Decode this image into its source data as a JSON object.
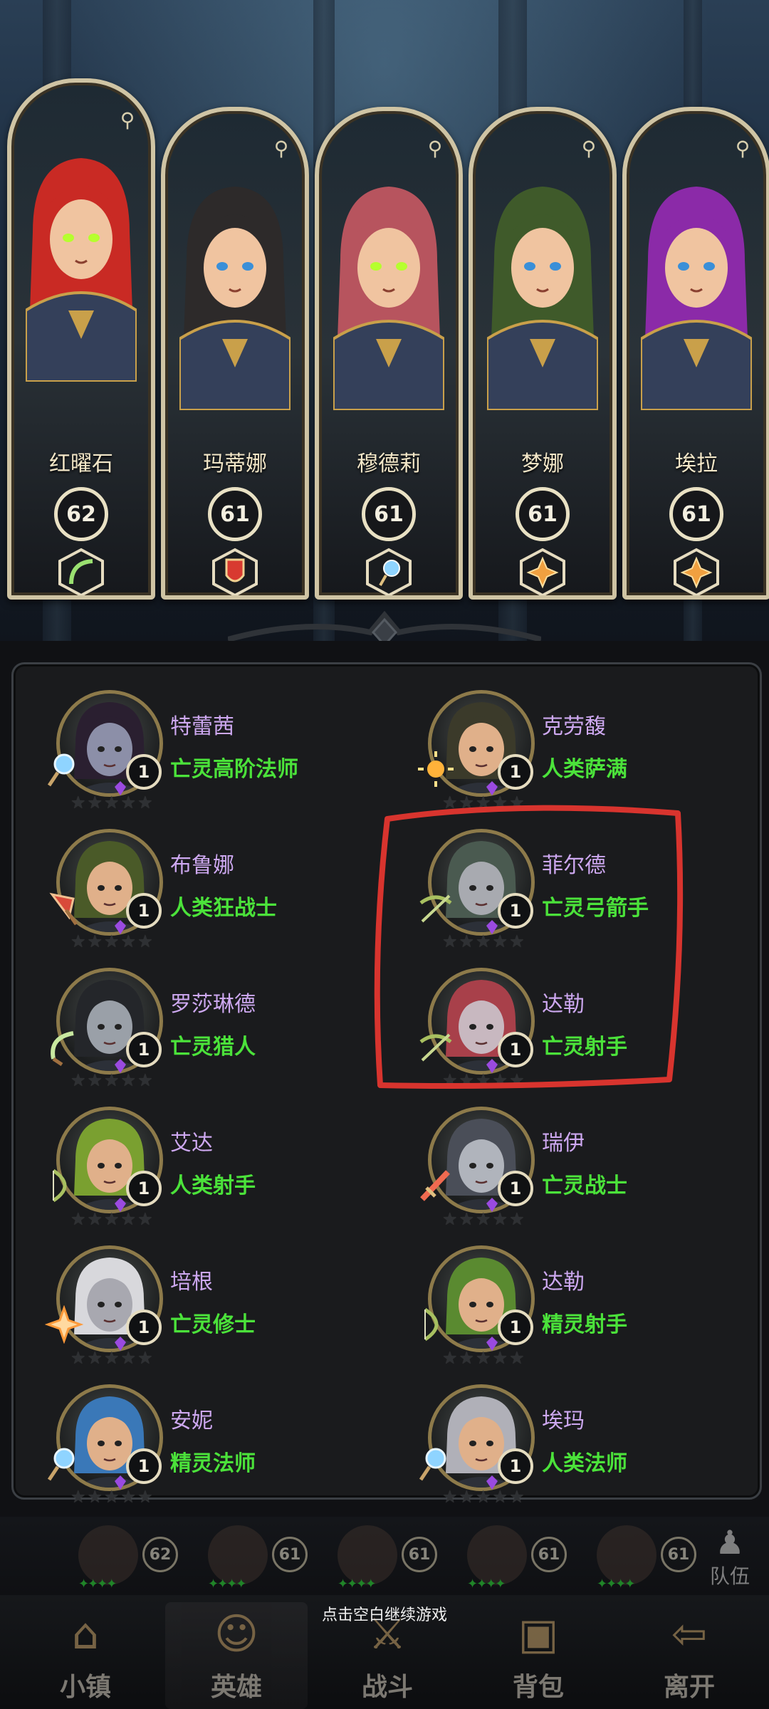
{
  "featured": [
    {
      "name": "红曜石",
      "level": "62",
      "class_icon": "scythe-icon",
      "hair": "#c92a24",
      "eyes": "#b6ff2e"
    },
    {
      "name": "玛蒂娜",
      "level": "61",
      "class_icon": "shield-icon",
      "hair": "#2d2a2a",
      "eyes": "#3a8fd8"
    },
    {
      "name": "穆德莉",
      "level": "61",
      "class_icon": "staff-orb-icon",
      "hair": "#b7545e",
      "eyes": "#b6ff2e"
    },
    {
      "name": "梦娜",
      "level": "61",
      "class_icon": "holy-emblem-icon",
      "hair": "#3f5a2a",
      "eyes": "#3a8fd8"
    },
    {
      "name": "埃拉",
      "level": "61",
      "class_icon": "holy-emblem-icon",
      "hair": "#8b2aa8",
      "eyes": "#3a8fd8"
    }
  ],
  "roster": [
    {
      "name": "特蕾茜",
      "class": "亡灵高阶法师",
      "level": "1",
      "weapon": "staff-orb-icon",
      "hair": "#2a1f30",
      "skin": "#8c8fa8"
    },
    {
      "name": "克劳馥",
      "class": "人类萨满",
      "level": "1",
      "weapon": "sun-icon",
      "hair": "#3b3a2a",
      "skin": "#e0b08a"
    },
    {
      "name": "布鲁娜",
      "class": "人类狂战士",
      "level": "1",
      "weapon": "axe-icon",
      "hair": "#4a5a28",
      "skin": "#e0b08a"
    },
    {
      "name": "菲尔德",
      "class": "亡灵弓箭手",
      "level": "1",
      "weapon": "crossbow-icon",
      "hair": "#4a5a50",
      "skin": "#a8aab0"
    },
    {
      "name": "罗莎琳德",
      "class": "亡灵猎人",
      "level": "1",
      "weapon": "sickle-icon",
      "hair": "#24262a",
      "skin": "#9aa0a8"
    },
    {
      "name": "达勒",
      "class": "亡灵射手",
      "level": "1",
      "weapon": "crossbow-icon",
      "hair": "#a8404a",
      "skin": "#c8b8c0"
    },
    {
      "name": "艾达",
      "class": "人类射手",
      "level": "1",
      "weapon": "bow-icon",
      "hair": "#7aa030",
      "skin": "#e0b08a"
    },
    {
      "name": "瑞伊",
      "class": "亡灵战士",
      "level": "1",
      "weapon": "sword-icon",
      "hair": "#4a4e58",
      "skin": "#b0b4bc"
    },
    {
      "name": "培根",
      "class": "亡灵修士",
      "level": "1",
      "weapon": "holy-cross-icon",
      "hair": "#d8d8dc",
      "skin": "#a8a8b0"
    },
    {
      "name": "达勒",
      "class": "精灵射手",
      "level": "1",
      "weapon": "bow-icon",
      "hair": "#5a8a30",
      "skin": "#e0b08a"
    },
    {
      "name": "安妮",
      "class": "精灵法师",
      "level": "1",
      "weapon": "staff-orb-icon",
      "hair": "#3a78b8",
      "skin": "#e0b08a"
    },
    {
      "name": "埃玛",
      "class": "人类法师",
      "level": "1",
      "weapon": "staff-orb-icon",
      "hair": "#b0b0b8",
      "skin": "#e0b08a"
    }
  ],
  "team": {
    "levels": [
      "62",
      "61",
      "61",
      "61",
      "61"
    ],
    "button_label": "队伍"
  },
  "hint": "点击空白继续游戏",
  "nav": [
    {
      "label": "小镇",
      "icon": "town-icon"
    },
    {
      "label": "英雄",
      "icon": "hero-icon"
    },
    {
      "label": "战斗",
      "icon": "battle-icon"
    },
    {
      "label": "背包",
      "icon": "backpack-icon"
    },
    {
      "label": "离开",
      "icon": "exit-icon"
    }
  ],
  "colors": {
    "hero_name": "#cda8f0",
    "hero_class": "#4be23a",
    "annotation": "#d8342e",
    "frame_gold": "#cfc4a4"
  }
}
